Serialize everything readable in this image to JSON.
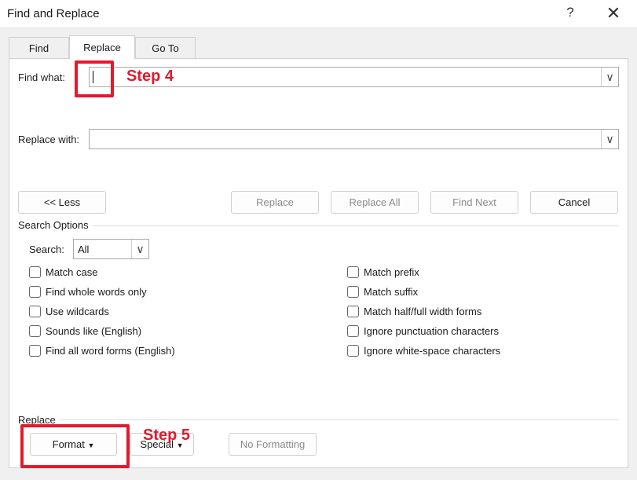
{
  "window": {
    "title": "Find and Replace",
    "help": "?",
    "close": "✕"
  },
  "tabs": [
    {
      "label": "Find"
    },
    {
      "label": "Replace"
    },
    {
      "label": "Go To"
    }
  ],
  "find": {
    "label": "Find what:",
    "value": ""
  },
  "replace": {
    "label": "Replace with:",
    "value": ""
  },
  "buttons": {
    "less": "<< Less",
    "replace": "Replace",
    "replace_all": "Replace All",
    "find_next": "Find Next",
    "cancel": "Cancel"
  },
  "search_options": {
    "heading": "Search Options",
    "search_label": "Search:",
    "search_value": "All"
  },
  "options_left": [
    {
      "label": "Match case",
      "checked": false
    },
    {
      "label": "Find whole words only",
      "checked": false
    },
    {
      "label": "Use wildcards",
      "checked": false
    },
    {
      "label": "Sounds like (English)",
      "checked": false
    },
    {
      "label": "Find all word forms (English)",
      "checked": false
    }
  ],
  "options_right": [
    {
      "label": "Match prefix",
      "checked": false
    },
    {
      "label": "Match suffix",
      "checked": false
    },
    {
      "label": "Match half/full width forms",
      "checked": false
    },
    {
      "label": "Ignore punctuation characters",
      "checked": false
    },
    {
      "label": "Ignore white-space characters",
      "checked": false
    }
  ],
  "replace_section": {
    "heading": "Replace",
    "format": "Format",
    "special": "Special",
    "no_formatting": "No Formatting"
  },
  "annotations": {
    "step4": "Step 4",
    "step5": "Step 5",
    "color": "#e01b2d"
  }
}
